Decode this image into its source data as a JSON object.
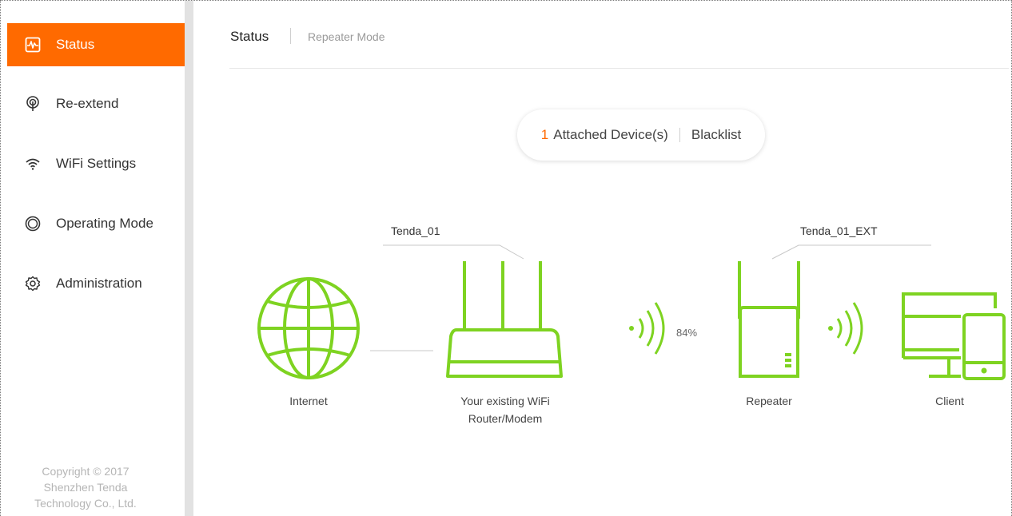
{
  "sidebar": {
    "items": [
      {
        "label": "Status",
        "icon": "pulse-monitor-icon",
        "active": true
      },
      {
        "label": "Re-extend",
        "icon": "signal-tower-icon",
        "active": false
      },
      {
        "label": "WiFi Settings",
        "icon": "wifi-icon",
        "active": false
      },
      {
        "label": "Operating Mode",
        "icon": "mode-circle-icon",
        "active": false
      },
      {
        "label": "Administration",
        "icon": "gear-icon",
        "active": false
      }
    ],
    "copyright": [
      "Copyright © 2017",
      "Shenzhen Tenda",
      "Technology Co., Ltd."
    ]
  },
  "header": {
    "title": "Status",
    "mode": "Repeater Mode"
  },
  "devices": {
    "count": "1",
    "label": "Attached Device(s)",
    "blacklist": "Blacklist"
  },
  "topology": {
    "upstream_ssid": "Tenda_01",
    "extended_ssid": "Tenda_01_EXT",
    "signal_strength": "84%",
    "internet_label": "Internet",
    "router_label_line1": "Your existing WiFi",
    "router_label_line2": "Router/Modem",
    "repeater_label": "Repeater",
    "client_label": "Client"
  },
  "colors": {
    "accent": "#ff6a00",
    "device_green": "#7ed321",
    "sidebar_scroll": "#e2e2e2"
  }
}
